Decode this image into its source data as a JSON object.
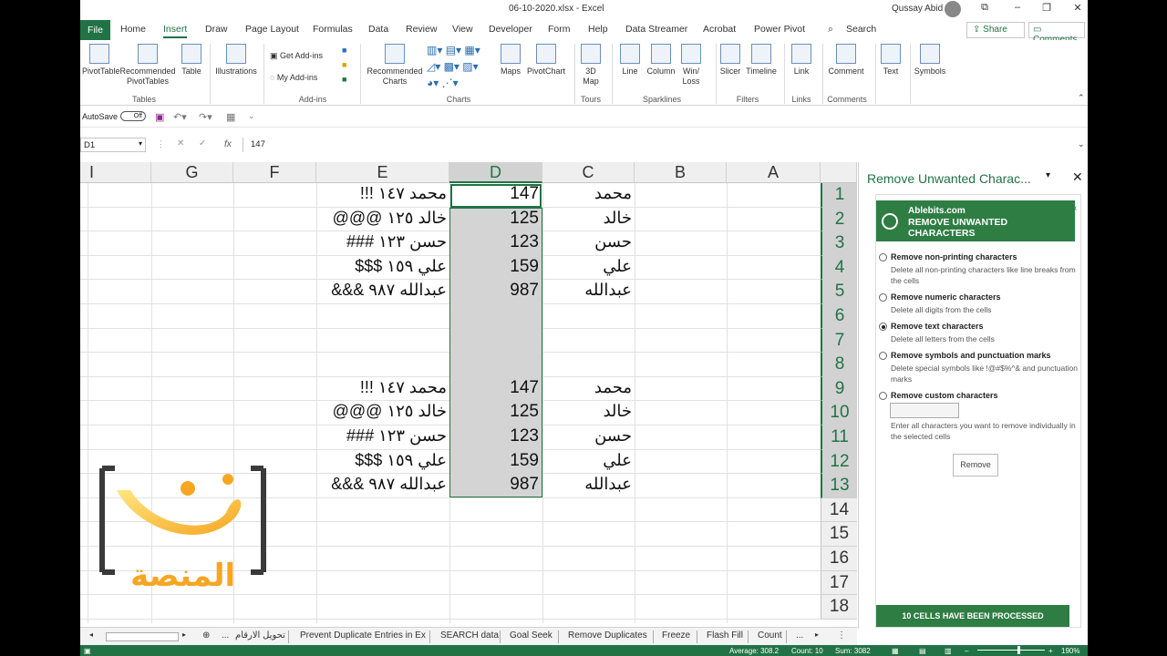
{
  "titlebar": {
    "file_title": "06-10-2020.xlsx  -  Excel",
    "user": "Qussay Abid",
    "minimize": "–",
    "restore": "❐",
    "close": "✕",
    "ribbon_opts": "⧉"
  },
  "tabs": {
    "file": "File",
    "items": [
      "Home",
      "Insert",
      "Draw",
      "Page Layout",
      "Formulas",
      "Data",
      "Review",
      "View",
      "Developer",
      "Form",
      "Help",
      "Data Streamer",
      "Acrobat",
      "Power Pivot"
    ],
    "active": "Insert",
    "search": "Search",
    "share": "Share",
    "comments": "Comments"
  },
  "ribbon": {
    "tables": {
      "pivottable": "PivotTable",
      "recommended": "Recommended PivotTables",
      "table": "Table",
      "group": "Tables"
    },
    "illustrations": {
      "label": "Illustrations"
    },
    "addins": {
      "get": "Get Add-ins",
      "my": "My Add-ins",
      "group": "Add-ins"
    },
    "charts": {
      "recommended": "Recommended Charts",
      "maps": "Maps",
      "pivotchart": "PivotChart",
      "group": "Charts"
    },
    "tours": {
      "map3d": "3D Map",
      "group": "Tours"
    },
    "sparklines": {
      "line": "Line",
      "column": "Column",
      "winloss": "Win/ Loss",
      "group": "Sparklines"
    },
    "filters": {
      "slicer": "Slicer",
      "timeline": "Timeline",
      "group": "Filters"
    },
    "links": {
      "link": "Link",
      "group": "Links"
    },
    "comments": {
      "comment": "Comment",
      "group": "Comments"
    },
    "text": {
      "text": "Text"
    },
    "symbols": {
      "symbols": "Symbols"
    }
  },
  "qat": {
    "autosave": "AutoSave",
    "toggle": "Off"
  },
  "formula_bar": {
    "name_box": "D1",
    "fx": "fx",
    "value": "147"
  },
  "grid": {
    "columns": [
      "I",
      "G",
      "F",
      "E",
      "D",
      "C",
      "B",
      "A"
    ],
    "rows": [
      "1",
      "2",
      "3",
      "4",
      "5",
      "6",
      "7",
      "8",
      "9",
      "10",
      "11",
      "12",
      "13",
      "14",
      "15",
      "16",
      "17",
      "18"
    ],
    "col_e": [
      "محمد ١٤٧ !!!",
      "خالد ١٢٥ @@@",
      "حسن ١٢٣ ###",
      "علي ١٥٩ $$$",
      "عبدالله ٩٨٧ &&&",
      "",
      "",
      "",
      "محمد ١٤٧ !!!",
      "خالد ١٢٥ @@@",
      "حسن ١٢٣ ###",
      "علي ١٥٩ $$$",
      "عبدالله ٩٨٧ &&&"
    ],
    "col_d": [
      "147",
      "125",
      "123",
      "159",
      "987",
      "",
      "",
      "",
      "147",
      "125",
      "123",
      "159",
      "987"
    ],
    "col_c": [
      "محمد",
      "خالد",
      "حسن",
      "علي",
      "عبدالله",
      "",
      "",
      "",
      "محمد",
      "خالد",
      "حسن",
      "علي",
      "عبدالله"
    ]
  },
  "sheets": {
    "tabs": [
      "تحويل الارقام",
      "Prevent Duplicate Entries in Ex",
      "SEARCH data",
      "Goal Seek",
      "Remove Duplicates",
      "Freeze",
      "Flash Fill",
      "Count"
    ],
    "ellipsis_left": "...",
    "ellipsis_right": "..."
  },
  "status": {
    "average": "Average: 308.2",
    "count": "Count: 10",
    "sum": "Sum: 3082",
    "zoom": "190%"
  },
  "pane": {
    "title": "Remove Unwanted Charac...",
    "brand": "Ablebits.com",
    "heading": "REMOVE UNWANTED CHARACTERS",
    "options": [
      {
        "label": "Remove non-printing characters",
        "desc": "Delete all non-printing characters like line breaks from the cells",
        "checked": false
      },
      {
        "label": "Remove numeric characters",
        "desc": "Delete all digits from the cells",
        "checked": false
      },
      {
        "label": "Remove text characters",
        "desc": "Delete all letters from the cells",
        "checked": true
      },
      {
        "label": "Remove symbols and punctuation marks",
        "desc": "Delete special symbols like !@#$%^& and punctuation marks",
        "checked": false
      },
      {
        "label": "Remove custom characters",
        "desc": "Enter all characters you want to remove individually in the selected cells",
        "checked": false
      }
    ],
    "remove_button": "Remove",
    "processed": "10 CELLS HAVE BEEN PROCESSED"
  },
  "colors": {
    "accent": "#217346",
    "pane_green": "#2e7d43",
    "selection": "#d4d4d4"
  }
}
